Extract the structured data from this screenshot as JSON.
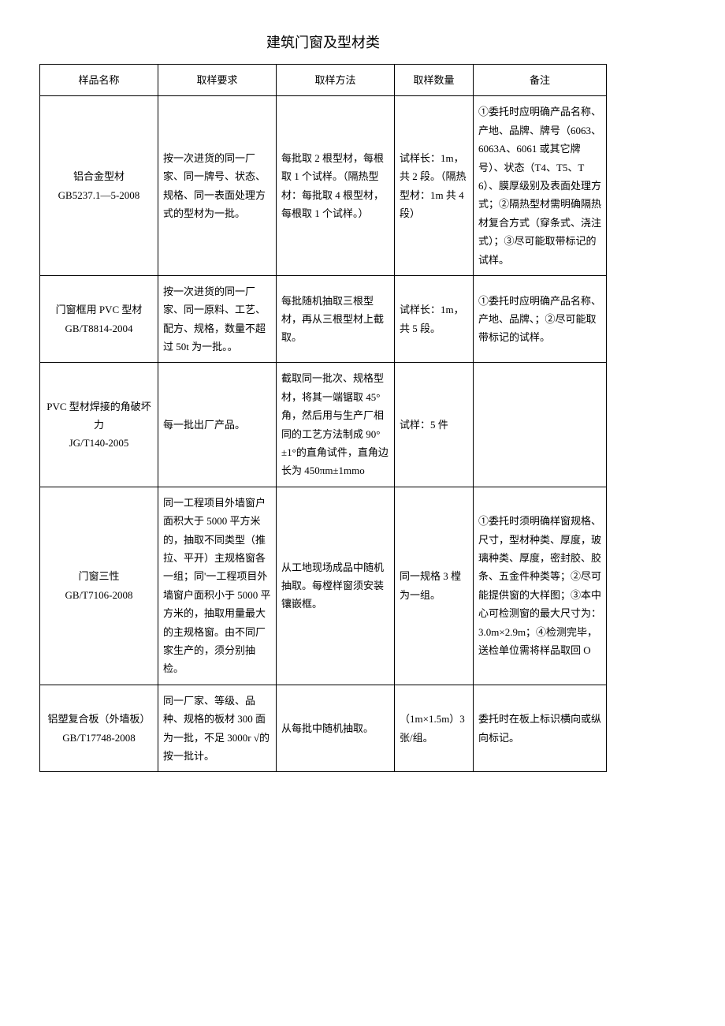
{
  "title": "建筑门窗及型材类",
  "headers": {
    "name": "样品名称",
    "req": "取样要求",
    "method": "取样方法",
    "qty": "取样数量",
    "note": "备注"
  },
  "rows": [
    {
      "name": "铝合金型材\nGB5237.1—5-2008",
      "req": "按一次进货的同一厂家、同一牌号、状态、规格、同一表面处理方式的型材为一批。",
      "method": "每批取 2 根型材，每根取 1 个试样。（隔热型材：每批取 4 根型材，每根取 1 个试样。）",
      "qty": "试样长：1m，共 2 段。（隔热型材：1m 共 4 段）",
      "note": "①委托时应明确产品名称、产地、品牌、牌号（6063、6063A、6061 或其它牌号）、状态（T4、T5、T6）、膜厚级别及表面处理方式；②隔热型材需明确隔热材复合方式（穿条式、浇注式）；③尽可能取带标记的试样。"
    },
    {
      "name": "门窗框用 PVC 型材\nGB/T8814-2004",
      "req": "按一次进货的同一厂家、同一原料、工艺、配方、规格，数量不超过 50t 为一批。。",
      "method": "每批随机抽取三根型材，再从三根型材上截取。",
      "qty": "试样长：1m，共 5 段。",
      "note": "①委托时应明确产品名称、产地、品牌、；②尽可能取带标记的试样。"
    },
    {
      "name": "PVC 型材焊接的角破坏力\nJG/T140-2005",
      "req": "每一批出厂产品。",
      "method": "截取同一批次、规格型材，将其一端锯取 45°角，然后用与生产厂相同的工艺方法制成 90°±1°的直角试件，直角边长为 450πm±1mmo",
      "qty": "试样：5 件",
      "note": ""
    },
    {
      "name": "门窗三性\nGB/T7106-2008",
      "req": "同一工程项目外墙窗户面积大于 5000 平方米的，抽取不同类型（推拉、平开）主规格窗各一组；同'一工程项目外墙窗户面积小于 5000 平方米的，抽取用量最大的主规格窗。由不同厂家生产的，须分别抽检。",
      "method": "从工地现场成品中随机抽取。每樘样窗须安装镶嵌框。",
      "qty": "同一规格 3 樘为一组。",
      "note": "①委托时须明确样窗规格、尺寸，型材种类、厚度，玻璃种类、厚度，密封胶、胶条、五金件种类等；②尽可能提供窗的大样图；③本中心可检测窗的最大尺寸为：3.0m×2.9m；④检测完毕，送检单位需将样品取回 O"
    },
    {
      "name": "铝塑复合板（外墙板）\nGB/T17748-2008",
      "req": "同一厂家、等级、品种、规格的板材 300 面为一批，不足 3000r √的按一批计。",
      "method": "从每批中随机抽取。",
      "qty": "（1m×1.5m）3 张/组。",
      "note": "委托时在板上标识横向或纵向标记。"
    }
  ]
}
